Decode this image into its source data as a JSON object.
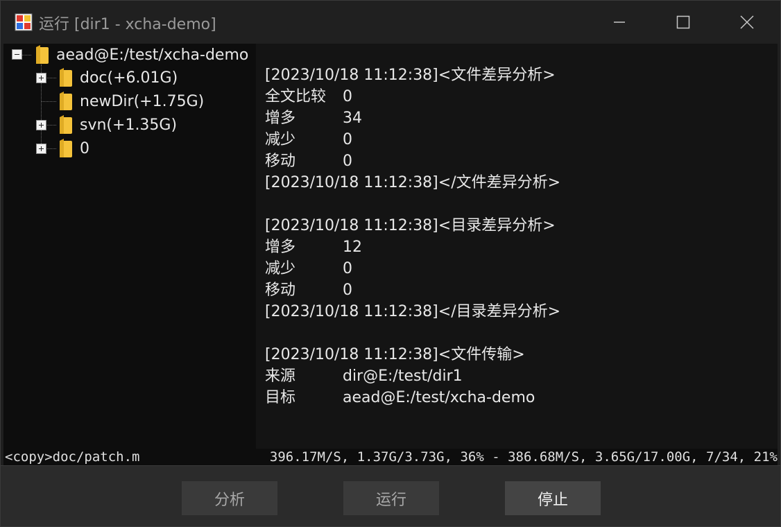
{
  "window": {
    "title": "运行 [dir1 - xcha-demo]",
    "icon": "app-window-icon",
    "controls": [
      "minimize-icon",
      "maximize-icon",
      "close-icon"
    ]
  },
  "tree": {
    "root": {
      "label": "aead@E:/test/xcha-demo",
      "expanded": true
    },
    "children": [
      {
        "label": "doc(+6.01G)",
        "expandable": true
      },
      {
        "label": "newDir(+1.75G)",
        "expandable": false
      },
      {
        "label": "svn(+1.35G)",
        "expandable": true
      },
      {
        "label": "0",
        "expandable": true
      }
    ]
  },
  "log": {
    "file_diff": {
      "header": "[2023/10/18 11:12:38]<文件差异分析>",
      "rows": [
        {
          "key": "全文比较",
          "value": "0"
        },
        {
          "key": "增多",
          "value": "34"
        },
        {
          "key": "减少",
          "value": "0"
        },
        {
          "key": "移动",
          "value": "0"
        }
      ],
      "footer": "[2023/10/18 11:12:38]</文件差异分析>"
    },
    "dir_diff": {
      "header": "[2023/10/18 11:12:38]<目录差异分析>",
      "rows": [
        {
          "key": "增多",
          "value": "12"
        },
        {
          "key": "减少",
          "value": "0"
        },
        {
          "key": "移动",
          "value": "0"
        }
      ],
      "footer": "[2023/10/18 11:12:38]</目录差异分析>"
    },
    "transfer": {
      "header": "[2023/10/18 11:12:38]<文件传输>",
      "rows": [
        {
          "key": "来源",
          "value": "dir@E:/test/dir1"
        },
        {
          "key": "目标",
          "value": "aead@E:/test/xcha-demo"
        }
      ]
    }
  },
  "status": {
    "current_file": "<copy>doc/patch.m",
    "progress": "396.17M/S, 1.37G/3.73G, 36% - 386.68M/S, 3.65G/17.00G, 7/34, 21%"
  },
  "buttons": {
    "analyze": "分析",
    "run": "运行",
    "stop": "停止"
  },
  "colors": {
    "folder": "#f5c33b",
    "background": "#1f1f1f",
    "tree_bg": "#0d0d0d",
    "log_bg": "#141414"
  }
}
